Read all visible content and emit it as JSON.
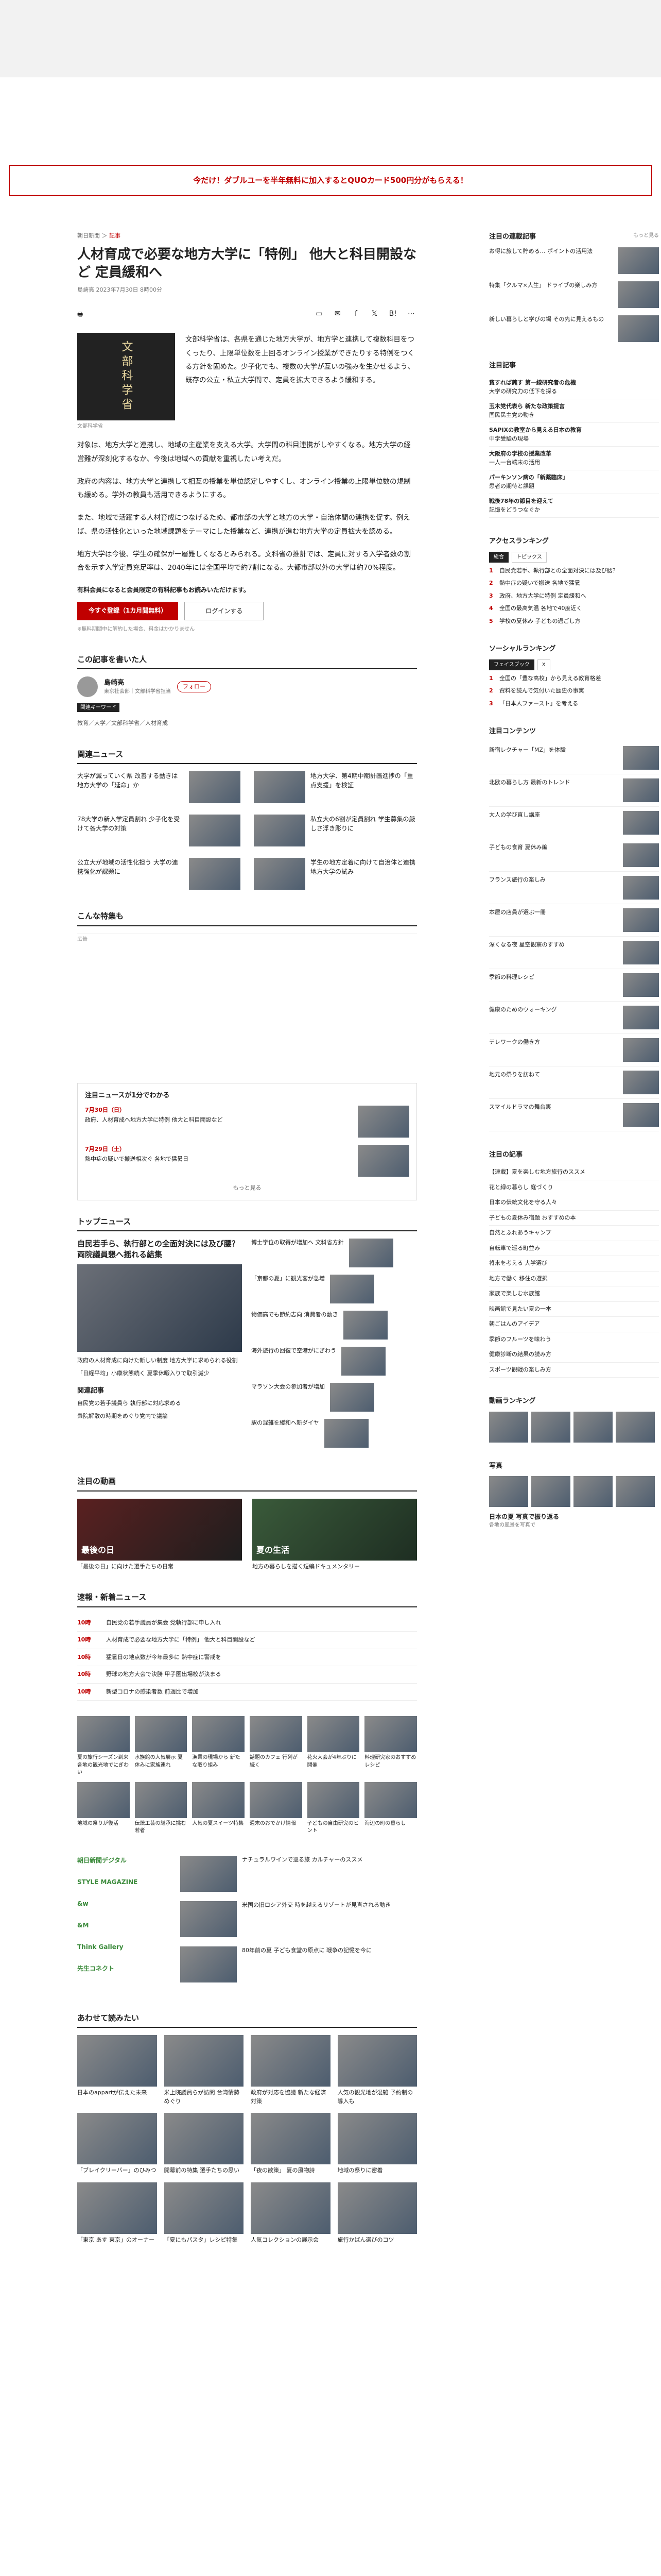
{
  "banner": {
    "text": "今だけ！ダブルユーを半年無料に加入するとQUOカード500円分がもらえる！"
  },
  "article": {
    "crumb_1": "朝日新聞",
    "crumb_2": "記事",
    "title": "人材育成で必要な地方大学に「特例」 他大と科目開設など 定員緩和へ",
    "meta": "島崎亮 2023年7月30日 8時00分",
    "photo_text": "文部科学省",
    "photo_caption": "文部科学省",
    "lead": "文部科学省は、各県を通じた地方大学が、地方学と連携して複数科目をつくったり、上限単位数を上回るオンライン授業ができたりする特例をつくる方針を固めた。少子化でも、複数の大学が互いの強みを生かせるよう、既存の公立・私立大学間で、定員を拡大できるよう緩和する。",
    "paragraphs": [
      "対象は、地方大学と連携し、地域の主産業を支える大学。大学間の科目連携がしやすくなる。地方大学の経営難が深刻化するなか、今後は地域への貢献を重視したい考えだ。",
      "政府の内容は、地方大学と連携して相互の授業を単位認定しやすくし、オンライン授業の上限単位数の規制も緩める。学外の教員も活用できるようにする。",
      "また、地域で活躍する人材育成につなげるため、都市部の大学と地方の大学・自治体間の連携を促す。例えば、県の活性化といった地域課題をテーマにした授業など、連携が進む地方大学の定員拡大を認める。",
      "地方大学は今後、学生の確保が一層難しくなるとみられる。文科省の推計では、定員に対する入学者数の割合を示す入学定員充足率は、2040年には全国平均で約7割になる。大都市部以外の大学は約70%程度。"
    ],
    "notice": "有料会員になると会員限定の有料記事もお読みいただけます。",
    "btn_subscribe": "今すぐ登録（1カ月間無料）",
    "btn_login": "ログインする",
    "small_note": "※無料期間中に解約した場合、料金はかかりません"
  },
  "author": {
    "section": "この記事を書いた人",
    "name": "島崎亮",
    "desc": "東京社会部｜文部科学省担当",
    "follow": "フォロー",
    "tag_head": "関連キーワード",
    "tags": "教育／大学／文部科学省／人材育成"
  },
  "related": {
    "section": "関連ニュース",
    "items": [
      "大学が減っていく県 改善する動きは地方大学の「延命」か",
      "地方大学、第4期中期計画進捗の「重点支援」を検証",
      "78大学の新入学定員割れ 少子化を受けて各大学の対策",
      "私立大の6割が定員割れ 学生募集の厳しさ浮き彫りに",
      "公立大が地域の活性化担う 大学の連携強化が課題に",
      "学生の地方定着に向けて自治体と連携 地方大学の試み"
    ]
  },
  "special": {
    "section": "こんな特集も",
    "ad_label": "広告"
  },
  "timeline": {
    "section": "注目ニュースが1分でわかる",
    "items": [
      {
        "date": "7月30日（日）",
        "text": "政府、人材育成へ地方大学に特例 他大と科目開設など"
      },
      {
        "date": "7月29日（土）",
        "text": "熱中症の疑いで搬送相次ぐ 各地で猛暑日"
      }
    ],
    "more": "もっと見る"
  },
  "topnews": {
    "section": "トップニュース",
    "lead_title": "自民若手ら、執行部との全面対決には及び腰？ 両院議員懇へ揺れる結集",
    "left_items": [
      "政府の人材育成に向けた新しい制度 地方大学に求められる役割",
      "「日経平均」小康状態続く 夏季休暇入りで取引減少"
    ],
    "right_items": [
      "博士学位の取得が増加へ 文科省方針",
      "「京都の夏」に観光客が急増",
      "物価高でも節約志向 消費者の動き",
      "海外旅行の回復で空港がにぎわう",
      "マラソン大会の参加者が増加",
      "駅の混雑を緩和へ新ダイヤ"
    ],
    "sub_section": "関連記事",
    "sub_items": [
      "自民党の若手議員ら 執行部に対応求める",
      "衆院解散の時期をめぐり党内で議論"
    ]
  },
  "video": {
    "section": "注目の動画",
    "items": [
      {
        "label": "最後の日",
        "caption": "「最後の日」に向けた選手たちの日常"
      },
      {
        "label": "夏の生活",
        "caption": "地方の暮らしを描く短編ドキュメンタリー"
      }
    ]
  },
  "breaking": {
    "section": "速報・新着ニュース",
    "items": [
      {
        "time": "10時",
        "text": "自民党の若手議員が集会 党執行部に申し入れ"
      },
      {
        "time": "10時",
        "text": "人材育成で必要な地方大学に「特例」 他大と科目開設など"
      },
      {
        "time": "10時",
        "text": "猛暑日の地点数が今年最多に 熱中症に警戒を"
      },
      {
        "time": "10時",
        "text": "野球の地方大会で決勝 甲子園出場校が決まる"
      },
      {
        "time": "10時",
        "text": "新型コロナの感染者数 前週比で増加"
      }
    ]
  },
  "grid6": [
    "夏の旅行シーズン到来 各地の観光地でにぎわい",
    "水族館の人気展示 夏休みに家族連れ",
    "漁業の現場から 新たな取り組み",
    "話題のカフェ 行列が続く",
    "花火大会が4年ぶりに開催",
    "料理研究家のおすすめレシピ",
    "地域の祭りが復活",
    "伝統工芸の継承に挑む若者",
    "人気の夏スイーツ特集",
    "週末のおでかけ情報",
    "子どもの自由研究のヒント",
    "海辺の町の暮らし"
  ],
  "promo": {
    "logos": [
      "朝日新聞デジタル",
      "STYLE MAGAZINE",
      "&w",
      "&M",
      "Think Gallery",
      "先生コネクト"
    ],
    "items": [
      "ナチュラルワインで巡る旅 カルチャーのススメ",
      "米国の旧ロシア外交 時を越えるリゾートが見直される動き",
      "80年前の夏 子ども食堂の原点に 戦争の記憶を今に"
    ]
  },
  "recommend": {
    "section": "あわせて読みたい",
    "items": [
      "日本のappartが伝えた未来",
      "米上院議員らが訪問 台湾情勢めぐり",
      "政府が対応を協議 新たな経済対策",
      "人気の観光地が混雑 予約制の導入も",
      "「ブレイクリーバー」のひみつ",
      "開幕前の特集 選手たちの思い",
      "「夜の散策」 夏の風物詩",
      "地域の祭りに密着",
      "「東京 あす 東京」のオーナー",
      "「夏にもパスタ」レシピ特集",
      "人気コレクションの展示会",
      "旅行かばん選びのコツ"
    ]
  },
  "side": {
    "topic_section": "注目の連載記事",
    "topic_more": "もっと見る",
    "topic_items": [
      "お得に旅して貯める… ポイントの活用法",
      "特集「クルマ×人生」 ドライブの楽しみ方",
      "新しい暮らしと学びの場 その先に見えるもの"
    ],
    "ranking_section": "注目記事",
    "ranking_items": [
      {
        "title": "貧すれば鈍す 第一線研究者の危機",
        "sub": "大学の研究力の低下を探る"
      },
      {
        "title": "玉木党代表ら 新たな政策提言",
        "sub": "国民民主党の動き"
      },
      {
        "title": "SAPIXの教室から見える日本の教育",
        "sub": "中学受験の現場"
      },
      {
        "title": "大阪府の学校の授業改革",
        "sub": "一人一台端末の活用"
      },
      {
        "title": "パーキンソン病の「新薬臨床」",
        "sub": "患者の期待と課題"
      },
      {
        "title": "戦後78年の節目を迎えて",
        "sub": "記憶をどうつなぐか"
      }
    ],
    "access_section": "アクセスランキング",
    "access_tabs": [
      "総合",
      "トピックス"
    ],
    "access_items": [
      "自民党若手、執行部との全面対決には及び腰？",
      "熱中症の疑いで搬送 各地で猛暑",
      "政府、地方大学に特例 定員緩和へ",
      "全国の最高気温 各地で40度近く",
      "学校の夏休み 子どもの過ごし方"
    ],
    "social_section": "ソーシャルランキング",
    "social_tabs": [
      "フェイスブック",
      "X"
    ],
    "social_items": [
      "全国の「豊な高校」から見える教育格差",
      "資料を読んで気付いた歴史の事実",
      "「日本人ファースト」を考える"
    ],
    "column_section": "注目コンテンツ",
    "column_items": [
      "新宿レクチャー「MZ」を体験",
      "北欧の暮らし方 最新のトレンド",
      "大人の学び直し講座",
      "子どもの食育 夏休み編",
      "フランス旅行の楽しみ",
      "本屋の店員が選ぶ一冊",
      "深くなる夜 星空観察のすすめ",
      "季節の料理レシピ",
      "健康のためのウォーキング",
      "テレワークの働き方",
      "地元の祭りを訪ねて",
      "スマイルドラマの舞台裏"
    ],
    "list_section": "注目の記事",
    "list_items": [
      "【連載】夏を楽しむ地方旅行のススメ",
      "花と緑の暮らし 庭づくり",
      "日本の伝統文化を守る人々",
      "子どもの夏休み宿題 おすすめの本",
      "自然とふれあうキャンプ",
      "自転車で巡る町並み",
      "将来を考える 大学選び",
      "地方で働く 移住の選択",
      "家族で楽しむ水族館",
      "映画館で見たい夏の一本",
      "朝ごはんのアイデア",
      "季節のフルーツを味わう",
      "健康診断の結果の読み方",
      "スポーツ観戦の楽しみ方"
    ],
    "newsrank_section": "動画ランキング",
    "photo_section": "写真",
    "photo_caption": "日本の夏 写真で振り返る",
    "photo_sub": "各地の風景を写真で"
  }
}
